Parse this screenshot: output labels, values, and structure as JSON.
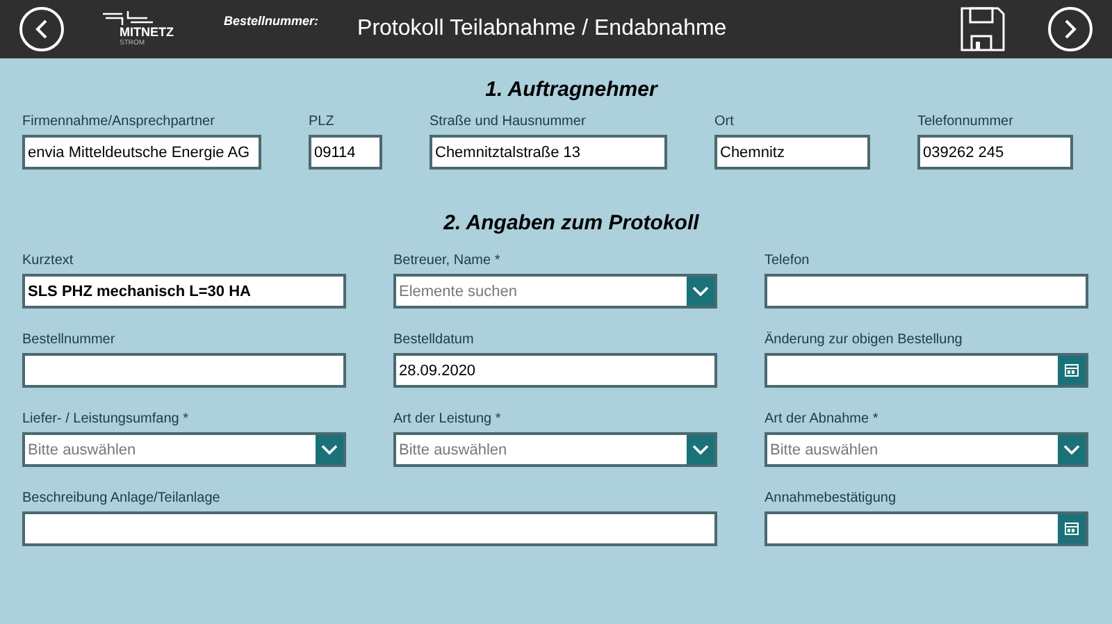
{
  "header": {
    "logo": {
      "name": "MITNETZ",
      "sub": "STROM"
    },
    "order_label": "Bestellnummer:",
    "title": "Protokoll Teilabnahme / Endabnahme"
  },
  "sections": [
    {
      "heading": "1. Auftragnehmer",
      "fields": [
        {
          "label": "Firmennahme/Ansprechpartner",
          "kind": "text",
          "value": "envia Mitteldeutsche Energie AG"
        },
        {
          "label": "PLZ",
          "kind": "text",
          "value": "09114"
        },
        {
          "label": "Straße und Hausnummer",
          "kind": "text",
          "value": "Chemnitztalstraße 13"
        },
        {
          "label": "Ort",
          "kind": "text",
          "value": "Chemnitz"
        },
        {
          "label": "Telefonnummer",
          "kind": "text",
          "value": "039262 245"
        }
      ]
    },
    {
      "heading": "2. Angaben zum Protokoll",
      "fields": [
        {
          "label": "Kurztext",
          "kind": "text",
          "value": "SLS PHZ mechanisch L=30 HA",
          "bold": true
        },
        {
          "label": "Betreuer, Name *",
          "kind": "dropdown",
          "placeholder": "Elemente suchen"
        },
        {
          "label": "Telefon",
          "kind": "text"
        },
        {
          "label": "Bestellnummer",
          "kind": "text"
        },
        {
          "label": "Bestelldatum",
          "kind": "text",
          "value": "28.09.2020"
        },
        {
          "label": "Änderung zur obigen Bestellung",
          "kind": "date"
        },
        {
          "label": "Liefer- / Leistungsumfang *",
          "kind": "dropdown",
          "placeholder": "Bitte auswählen"
        },
        {
          "label": "Art der Leistung *",
          "kind": "dropdown",
          "placeholder": "Bitte auswählen"
        },
        {
          "label": "Art der Abnahme *",
          "kind": "dropdown",
          "placeholder": "Bitte auswählen"
        },
        {
          "label": "Beschreibung Anlage/Teilanlage",
          "kind": "text",
          "wide": true
        },
        {
          "label": "Annahmebestätigung",
          "kind": "date"
        }
      ]
    }
  ]
}
